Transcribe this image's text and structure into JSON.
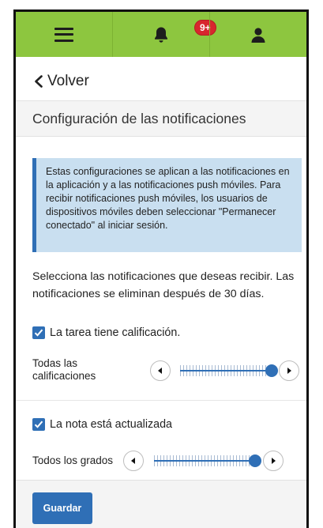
{
  "topbar": {
    "menu_icon": "hamburger-icon",
    "notifications_icon": "bell-icon",
    "notifications_badge": "9+",
    "profile_icon": "user-icon"
  },
  "nav": {
    "back_label": "Volver"
  },
  "page": {
    "title": "Configuración de las notificaciones"
  },
  "info_box": {
    "text": "Estas configuraciones se aplican a las notificaciones en la aplicación y a las notificaciones push móviles. Para recibir notificaciones push móviles, los usuarios de dispositivos móviles deben seleccionar \"Permanecer conectado\" al iniciar sesión."
  },
  "description": "Selecciona las notificaciones que deseas recibir. Las notificaciones se eliminan después de 30 días.",
  "settings": [
    {
      "checkbox_label": "La tarea tiene calificación.",
      "checked": true,
      "slider_label": "Todas las calificaciones",
      "slider_value_fraction": 1.0
    },
    {
      "checkbox_label": "La nota está actualizada",
      "checked": true,
      "slider_label": "Todos los grados",
      "slider_value_fraction": 1.0
    }
  ],
  "footer": {
    "save_label": "Guardar"
  },
  "colors": {
    "topbar": "#8dc63f",
    "accent": "#2f6fb6",
    "info_bg": "#c9dff0",
    "badge": "#d8262e"
  }
}
